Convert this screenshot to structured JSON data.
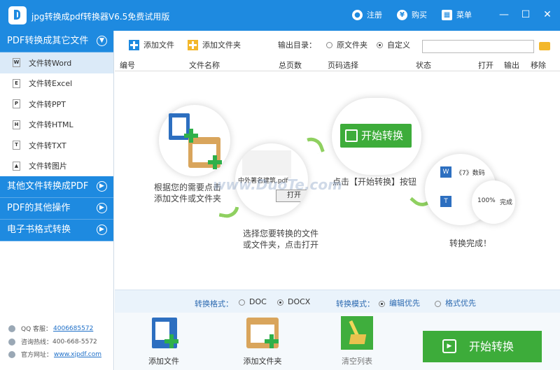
{
  "app": {
    "title": "jpg转换成pdf转换器V6.5免费试用版",
    "register": "注册",
    "buy": "购买",
    "menu": "菜单"
  },
  "sidebar": {
    "categories": [
      {
        "label": "PDF转换成其它文件"
      },
      {
        "label": "其他文件转换成PDF"
      },
      {
        "label": "PDF的其他操作"
      },
      {
        "label": "电子书格式转换"
      }
    ],
    "items": [
      {
        "label": "文件转Word",
        "icon": "W"
      },
      {
        "label": "文件转Excel",
        "icon": "E"
      },
      {
        "label": "文件转PPT",
        "icon": "P"
      },
      {
        "label": "文件转HTML",
        "icon": "H"
      },
      {
        "label": "文件转TXT",
        "icon": "T"
      },
      {
        "label": "文件转图片",
        "icon": "▲"
      }
    ],
    "contact": {
      "qq_label": "QQ 客服：",
      "qq": "4006685572",
      "hotline_label": "咨询热线：",
      "hotline": "400-668-5572",
      "site_label": "官方网址：",
      "site": "www.xjpdf.com"
    }
  },
  "toolbar": {
    "add_file": "添加文件",
    "add_folder": "添加文件夹",
    "output_label": "输出目录：",
    "option_original": "原文件夹",
    "option_custom": "自定义",
    "path_value": ""
  },
  "table": {
    "columns": [
      "编号",
      "文件名称",
      "总页数",
      "页码选择",
      "状态",
      "打开",
      "输出",
      "移除"
    ]
  },
  "guide": {
    "step1": [
      "根据您的需要点击",
      "添加文件或文件夹"
    ],
    "step2": [
      "选择您要转换的文件",
      "或文件夹，点击打开"
    ],
    "step3": "点击【开始转换】按钮",
    "step4": "转换完成！",
    "start_label": "开始转换",
    "file_name": "中外著名建筑.pdf",
    "open_btn": "打开",
    "doc_label": "《7》数码",
    "progress": "100%",
    "done_word": "完成"
  },
  "format_bar": {
    "format_label": "转换格式：",
    "doc": "DOC",
    "docx": "DOCX",
    "mode_label": "转换模式：",
    "mode_edit": "编辑优先",
    "mode_format": "格式优先"
  },
  "bottom": {
    "add_file": "添加文件",
    "add_folder": "添加文件夹",
    "clear": "清空列表",
    "start": "开始转换"
  }
}
